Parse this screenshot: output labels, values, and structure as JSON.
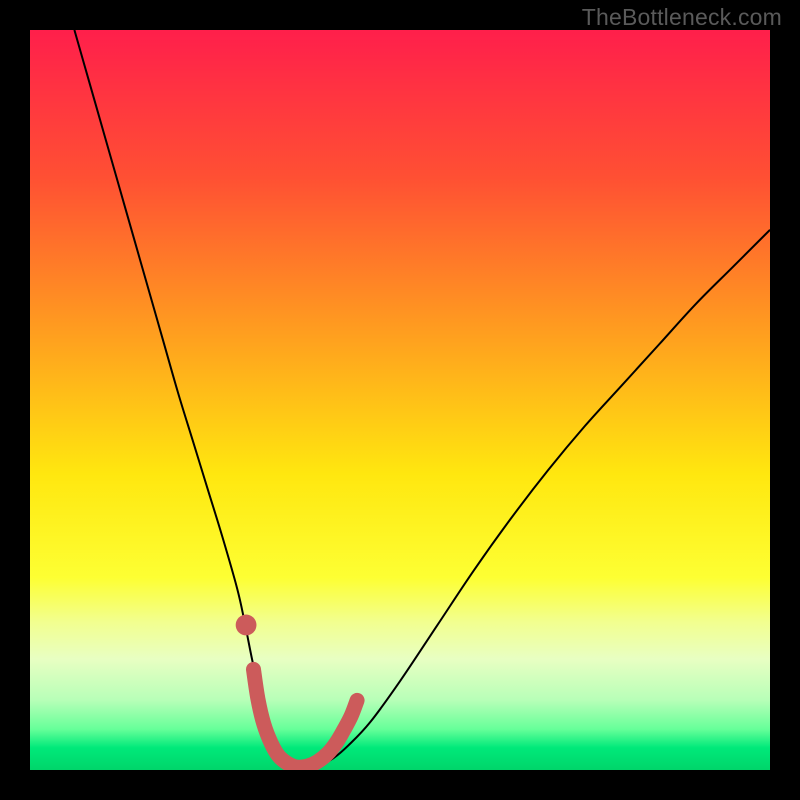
{
  "watermark": "TheBottleneck.com",
  "chart_data": {
    "type": "line",
    "title": "",
    "xlabel": "",
    "ylabel": "",
    "xlim": [
      0,
      100
    ],
    "ylim": [
      0,
      100
    ],
    "grid": false,
    "legend": false,
    "gradient_stops": [
      {
        "offset": 0.0,
        "color": "#ff1f4b"
      },
      {
        "offset": 0.2,
        "color": "#ff5033"
      },
      {
        "offset": 0.42,
        "color": "#ffa21e"
      },
      {
        "offset": 0.6,
        "color": "#ffe70f"
      },
      {
        "offset": 0.74,
        "color": "#fdff33"
      },
      {
        "offset": 0.8,
        "color": "#f2ff8f"
      },
      {
        "offset": 0.85,
        "color": "#e8ffc2"
      },
      {
        "offset": 0.905,
        "color": "#b8ffb8"
      },
      {
        "offset": 0.945,
        "color": "#66ff99"
      },
      {
        "offset": 0.97,
        "color": "#00e97a"
      },
      {
        "offset": 1.0,
        "color": "#00d56a"
      }
    ],
    "series": [
      {
        "name": "bottleneck-curve",
        "style": "thin-black",
        "x": [
          6,
          8,
          10,
          12,
          14,
          16,
          18,
          20,
          22,
          24,
          26,
          28,
          29,
          30,
          31,
          32,
          33,
          34,
          35,
          37,
          39,
          41,
          43,
          46,
          50,
          55,
          60,
          65,
          70,
          75,
          80,
          85,
          90,
          95,
          100
        ],
        "y": [
          100,
          93,
          86,
          79,
          72,
          65,
          58,
          51,
          44.5,
          38,
          31.5,
          24.5,
          20,
          15,
          10.5,
          6.5,
          3.5,
          1.8,
          0.8,
          0.2,
          0.6,
          1.6,
          3.3,
          6.5,
          12,
          19.5,
          27,
          34,
          40.5,
          46.5,
          52,
          57.5,
          63,
          68,
          73
        ]
      },
      {
        "name": "optimal-zone",
        "style": "thick-red",
        "x": [
          30.2,
          30.8,
          31.6,
          32.6,
          33.6,
          34.8,
          36.0,
          37.4,
          38.8,
          40.2,
          41.4,
          42.4,
          43.4,
          44.2
        ],
        "y": [
          13.6,
          9.6,
          6.2,
          3.6,
          1.9,
          0.9,
          0.4,
          0.5,
          1.1,
          2.2,
          3.7,
          5.4,
          7.3,
          9.4
        ]
      }
    ],
    "markers": [
      {
        "name": "optimal-dot",
        "x": 29.2,
        "y": 19.6,
        "r": 1.0,
        "color": "#cc5b5b"
      }
    ]
  }
}
